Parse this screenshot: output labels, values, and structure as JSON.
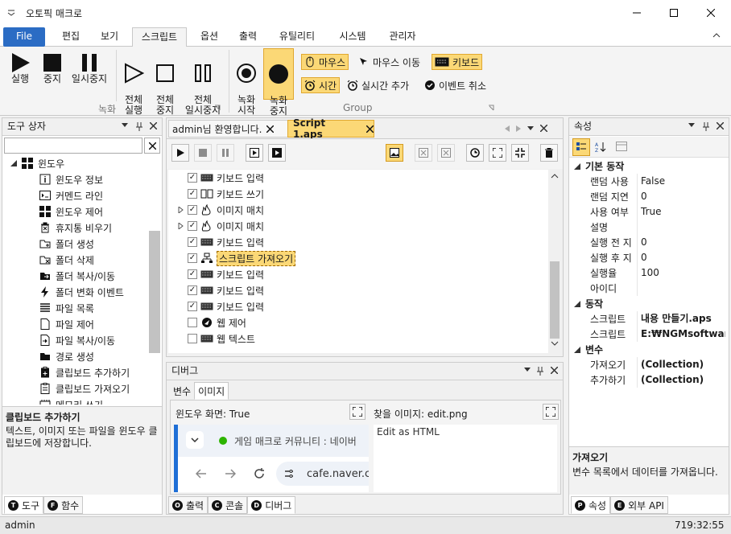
{
  "window": {
    "title": "오토픽 매크로"
  },
  "ribbon_tabs": [
    {
      "label": "File"
    },
    {
      "label": "편집"
    },
    {
      "label": "보기"
    },
    {
      "label": "스크립트"
    },
    {
      "label": "옵션"
    },
    {
      "label": "출력"
    },
    {
      "label": "유틸리티"
    },
    {
      "label": "시스템"
    },
    {
      "label": "관리자"
    }
  ],
  "ribbon": {
    "group1_label": "녹화",
    "group2_label": "Group",
    "buttons": [
      {
        "label": "실행"
      },
      {
        "label": "중지"
      },
      {
        "label": "일시중지"
      },
      {
        "label": "전체\n실행"
      },
      {
        "label": "전체\n중지"
      },
      {
        "label": "전체\n일시중지"
      },
      {
        "label": "녹화\n시작"
      },
      {
        "label": "녹화\n중지"
      }
    ],
    "small": {
      "mouse": "마우스",
      "mouse_move": "마우스 이동",
      "keyboard": "키보드",
      "time": "시간",
      "realtime_add": "실시간 추가",
      "event_cancel": "이벤트 취소"
    }
  },
  "toolbox": {
    "title": "도구 상자",
    "search_placeholder": "",
    "root": "윈도우",
    "items": [
      "윈도우 정보",
      "커멘드 라인",
      "윈도우 제어",
      "휴지통 비우기",
      "폴더 생성",
      "폴더 삭제",
      "폴더 복사/이동",
      "폴더 변화 이벤트",
      "파일 목록",
      "파일 제어",
      "파일 복사/이동",
      "경로 생성",
      "클립보드 추가하기",
      "클립보드 가져오기",
      "메모리 쓰기"
    ],
    "desc_title": "클립보드 추가하기",
    "desc_text": "텍스트, 이미지 또는 파일을 윈도우 클립보드에 저장합니다.",
    "tabs": [
      {
        "letter": "T",
        "label": "도구"
      },
      {
        "letter": "F",
        "label": "함수"
      }
    ]
  },
  "editor": {
    "tabs": [
      {
        "label": "admin님 환영합니다."
      },
      {
        "label": "Script 1.aps"
      }
    ],
    "lines": [
      {
        "label": "키보드 입력",
        "checked": true,
        "expand": false
      },
      {
        "label": "키보드 쓰기",
        "checked": true,
        "expand": false
      },
      {
        "label": "이미지 매치",
        "checked": true,
        "expand": true
      },
      {
        "label": "이미지 매치",
        "checked": true,
        "expand": true
      },
      {
        "label": "키보드 입력",
        "checked": true,
        "expand": false
      },
      {
        "label": "스크립트 가져오기",
        "checked": true,
        "expand": false,
        "selected": true
      },
      {
        "label": "키보드 입력",
        "checked": true,
        "expand": false
      },
      {
        "label": "키보드 입력",
        "checked": true,
        "expand": false
      },
      {
        "label": "키보드 입력",
        "checked": true,
        "expand": false
      },
      {
        "label": "웹 제어",
        "checked": false,
        "expand": false
      },
      {
        "label": "웹 텍스트",
        "checked": false,
        "expand": false
      }
    ]
  },
  "debug": {
    "title": "디버그",
    "tabs": [
      {
        "label": "변수"
      },
      {
        "label": "이미지"
      }
    ],
    "window_label": "윈도우 화면: True",
    "find_label": "찾을 이미지: edit.png",
    "find_text": "Edit as HTML",
    "browser_tab": "게임 매크로 커뮤니티 : 네이버",
    "browser_url": "cafe.naver.c",
    "bottom_tabs": [
      {
        "letter": "O",
        "label": "출력"
      },
      {
        "letter": "C",
        "label": "콘솔"
      },
      {
        "letter": "D",
        "label": "디버그"
      }
    ]
  },
  "properties": {
    "title": "속성",
    "cats": [
      {
        "name": "기본 동작",
        "rows": [
          [
            "랜덤 사용",
            "False"
          ],
          [
            "랜덤 지연",
            "0"
          ],
          [
            "사용 여부",
            "True"
          ],
          [
            "설명",
            ""
          ],
          [
            "실행 전 지",
            "0"
          ],
          [
            "실행 후 지",
            "0"
          ],
          [
            "실행율",
            "100"
          ],
          [
            "아이디",
            ""
          ]
        ]
      },
      {
        "name": "동작",
        "rows": [
          [
            "스크립트",
            "내용 만들기.aps"
          ],
          [
            "스크립트",
            "E:₩NGMsoftware₩I"
          ]
        ]
      },
      {
        "name": "변수",
        "rows": [
          [
            "가져오기",
            "(Collection)"
          ],
          [
            "추가하기",
            "(Collection)"
          ]
        ]
      }
    ],
    "desc_title": "가져오기",
    "desc_text": "변수 목록에서 데이터를 가져옵니다.",
    "tabs": [
      {
        "letter": "P",
        "label": "속성"
      },
      {
        "letter": "E",
        "label": "외부 API"
      }
    ]
  },
  "status": {
    "user": "admin",
    "clock": "719:32:55"
  }
}
